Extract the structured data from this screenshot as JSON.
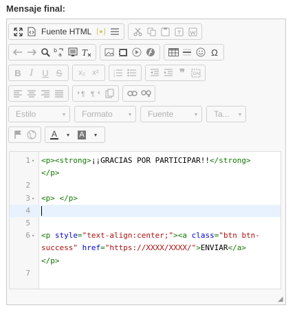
{
  "field_label": "Mensaje final:",
  "toolbar": {
    "source_label": "Fuente HTML",
    "combos": [
      {
        "name": "style",
        "label": "Estilo"
      },
      {
        "name": "format",
        "label": "Formato"
      },
      {
        "name": "font",
        "label": "Fuente"
      },
      {
        "name": "size",
        "label": "Ta..."
      }
    ],
    "arrow": "▾",
    "glyphs": {
      "bold": "B",
      "italic": "I",
      "underline": "U",
      "strike": "S",
      "subscript": "x₂",
      "superscript": "x²",
      "quote": "❞",
      "omega": "Ω",
      "text_color": "A",
      "bg_color": "A",
      "dropdown": "▾"
    }
  },
  "code": {
    "lines": [
      {
        "n": "1",
        "fold": true,
        "segments": [
          {
            "t": "tag",
            "v": "<p><strong>"
          },
          {
            "t": "txtc",
            "v": "¡¡GRACIAS POR PARTICIPAR!!"
          },
          {
            "t": "tag",
            "v": "</strong>"
          }
        ]
      },
      {
        "n": "",
        "fold": false,
        "segments": [
          {
            "t": "tag",
            "v": "</p>"
          }
        ]
      },
      {
        "n": "2",
        "fold": false,
        "segments": []
      },
      {
        "n": "3",
        "fold": true,
        "segments": [
          {
            "t": "tag",
            "v": "<p>"
          },
          {
            "t": "txtc",
            "v": " "
          },
          {
            "t": "tag",
            "v": "</p>"
          }
        ]
      },
      {
        "n": "4",
        "fold": false,
        "segments": [],
        "active": true
      },
      {
        "n": "5",
        "fold": false,
        "segments": []
      },
      {
        "n": "6",
        "fold": true,
        "segments": [
          {
            "t": "tag",
            "v": "<p "
          },
          {
            "t": "attr",
            "v": "style"
          },
          {
            "t": "tag",
            "v": "="
          },
          {
            "t": "str",
            "v": "\"text-align:center;\""
          },
          {
            "t": "tag",
            "v": "><a "
          },
          {
            "t": "attr",
            "v": "class"
          },
          {
            "t": "tag",
            "v": "="
          },
          {
            "t": "str",
            "v": "\"btn btn-"
          }
        ]
      },
      {
        "n": "",
        "fold": false,
        "segments": [
          {
            "t": "str",
            "v": "success\""
          },
          {
            "t": "txtc",
            "v": " "
          },
          {
            "t": "attr",
            "v": "href"
          },
          {
            "t": "tag",
            "v": "="
          },
          {
            "t": "str",
            "v": "\"https://XXXX/XXXX/\""
          },
          {
            "t": "tag",
            "v": ">"
          },
          {
            "t": "txtc",
            "v": "ENVIAR"
          },
          {
            "t": "tag",
            "v": "</a>"
          }
        ]
      },
      {
        "n": "",
        "fold": false,
        "segments": [
          {
            "t": "tag",
            "v": "</p>"
          }
        ]
      },
      {
        "n": "7",
        "fold": false,
        "segments": []
      }
    ]
  }
}
